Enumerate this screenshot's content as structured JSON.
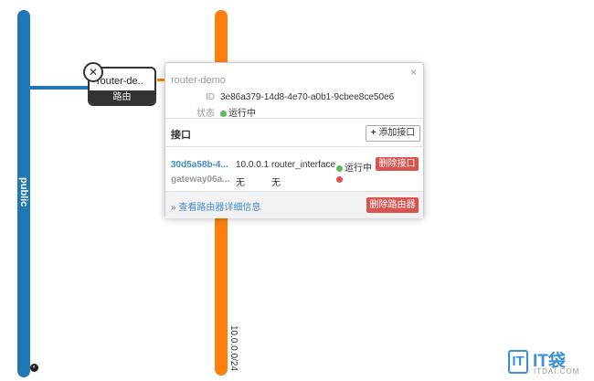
{
  "networks": {
    "public": {
      "label": "public",
      "color": "#1f77b4"
    },
    "private": {
      "label": "10.0.0.0/24",
      "color": "#ff7f0e"
    }
  },
  "router": {
    "name": "router-de..",
    "type": "路由",
    "icon": "router-icon"
  },
  "popup": {
    "title": "router-demo",
    "close": "×",
    "id_label": "ID",
    "id_value": "3e86a379-14d8-4e70-a0b1-9cbee8ce50e6",
    "status_label": "状态",
    "status_value": "运行中",
    "interfaces_title": "接口",
    "add_interface": "添加接口",
    "add_icon": "+",
    "interfaces": [
      {
        "id": "30d5a58b-4...",
        "ip": "10.0.0.1",
        "type": "router_interface",
        "status": "运行中",
        "status_color": "#5cb85c",
        "delete": "删除接口"
      },
      {
        "id": "gateway06a...",
        "ip": "无",
        "type": "无",
        "status": "",
        "status_color": "#d9534f"
      }
    ],
    "detail_link": "» 查看路由器详细信息",
    "delete_router": "删除路由器"
  },
  "watermark": {
    "logo": "IT",
    "brand": "IT袋",
    "domain": "ITDAI.COM"
  }
}
